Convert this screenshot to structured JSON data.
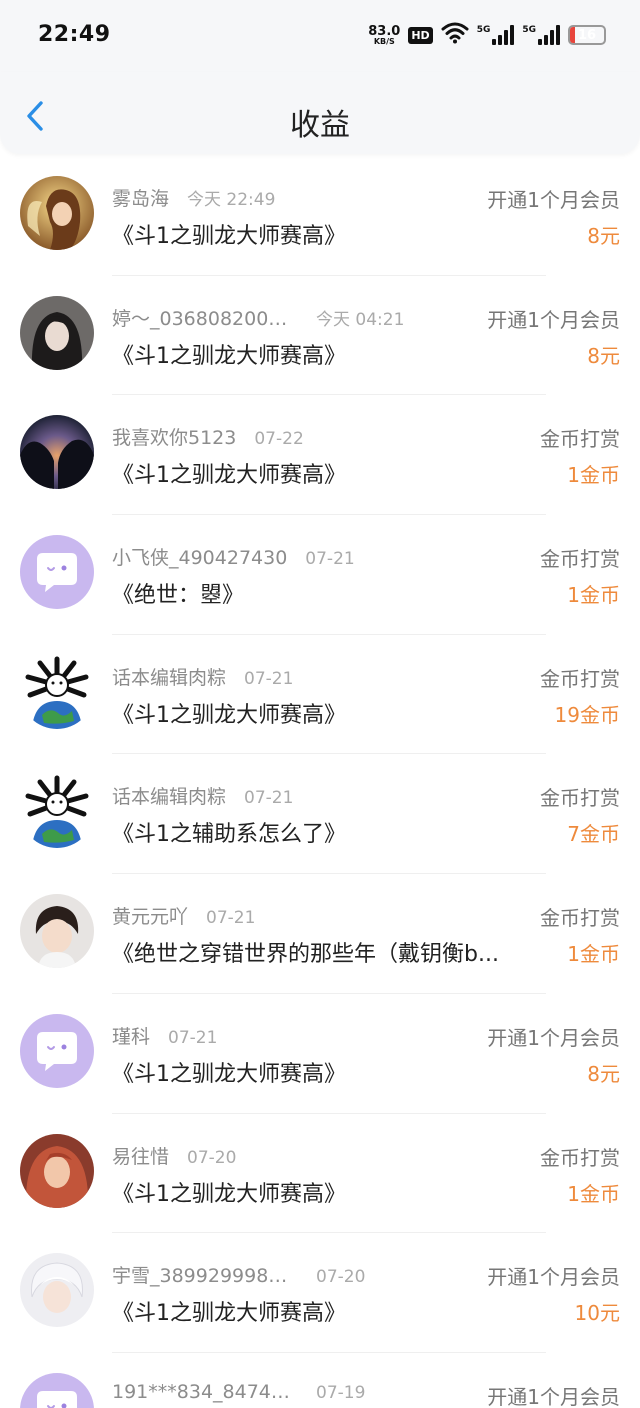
{
  "status_bar": {
    "time": "22:49",
    "net_speed_value": "83.0",
    "net_speed_unit": "KB/S",
    "hd_badge": "HD",
    "sim1_label": "5G",
    "sim2_label": "5G",
    "battery_level": "16",
    "battery_fraction": 0.16,
    "battery_color": "#e8453c"
  },
  "header": {
    "title": "收益",
    "back_icon": "chevron-left-icon",
    "back_color": "#2a8ee6"
  },
  "colors": {
    "amount": "#ee8a3c",
    "default_avatar": "#c9b8ef"
  },
  "records": [
    {
      "name": "雾岛海",
      "time": "今天 22:49",
      "book": "《斗1之驯龙大师赛高》",
      "type": "开通1个月会员",
      "amount": "8元",
      "avatar": "fairy-girl-avatar"
    },
    {
      "name": "婷～_0368082005...",
      "time": "今天 04:21",
      "book": "《斗1之驯龙大师赛高》",
      "type": "开通1个月会员",
      "amount": "8元",
      "avatar": "dark-hair-girl-avatar"
    },
    {
      "name": "我喜欢你5123",
      "time": "07-22",
      "book": "《斗1之驯龙大师赛高》",
      "type": "金币打赏",
      "amount": "1金币",
      "avatar": "silhouette-couple-avatar"
    },
    {
      "name": "小飞侠_490427430",
      "time": "07-21",
      "book": "《绝世：曌》",
      "type": "金币打赏",
      "amount": "1金币",
      "avatar": "default-chat-bubble-avatar"
    },
    {
      "name": "话本编辑肉粽",
      "time": "07-21",
      "book": "《斗1之驯龙大师赛高》",
      "type": "金币打赏",
      "amount": "19金币",
      "avatar": "globe-dog-avatar"
    },
    {
      "name": "话本编辑肉粽",
      "time": "07-21",
      "book": "《斗1之辅助系怎么了》",
      "type": "金币打赏",
      "amount": "7金币",
      "avatar": "globe-dog-avatar"
    },
    {
      "name": "黄元元吖",
      "time": "07-21",
      "book": "《绝世之穿错世界的那些年（戴钥衡b...",
      "type": "金币打赏",
      "amount": "1金币",
      "avatar": "child-portrait-avatar"
    },
    {
      "name": "瑾科",
      "time": "07-21",
      "book": "《斗1之驯龙大师赛高》",
      "type": "开通1个月会员",
      "amount": "8元",
      "avatar": "default-chat-bubble-avatar"
    },
    {
      "name": "易往惜",
      "time": "07-20",
      "book": "《斗1之驯龙大师赛高》",
      "type": "金币打赏",
      "amount": "1金币",
      "avatar": "red-hair-girl-avatar"
    },
    {
      "name": "宇雪_3899299982...",
      "time": "07-20",
      "book": "《斗1之驯龙大师赛高》",
      "type": "开通1个月会员",
      "amount": "10元",
      "avatar": "white-hair-boy-avatar"
    },
    {
      "name": "191***834_84743...",
      "time": "07-19",
      "book": "",
      "type": "开通1个月会员",
      "amount": "",
      "avatar": "default-chat-bubble-avatar"
    }
  ]
}
